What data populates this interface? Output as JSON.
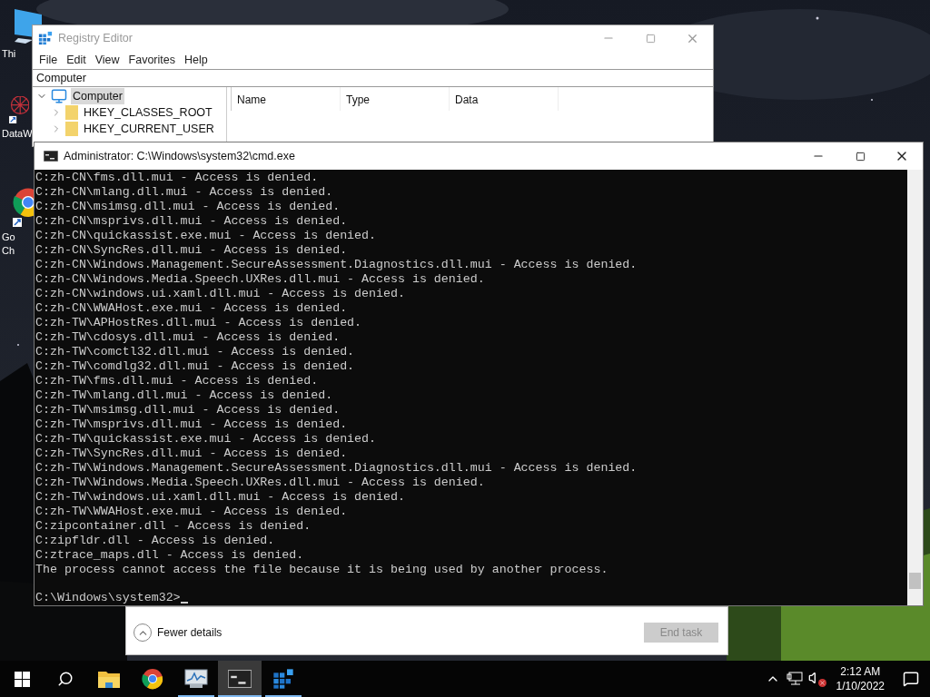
{
  "desktop_icons": [
    {
      "kind": "pc",
      "lines": [
        "Thi"
      ]
    },
    {
      "kind": "network",
      "lines": [
        "DataW"
      ]
    },
    {
      "kind": "chrome",
      "lines": [
        "Go",
        "Ch"
      ]
    }
  ],
  "registry": {
    "title": "Registry Editor",
    "menu": [
      "File",
      "Edit",
      "View",
      "Favorites",
      "Help"
    ],
    "address": "Computer",
    "tree": {
      "label": "Computer",
      "selected": true,
      "expanded": true,
      "children": [
        {
          "label": "HKEY_CLASSES_ROOT",
          "expanded": false
        },
        {
          "label": "HKEY_CURRENT_USER",
          "expanded": false
        }
      ]
    },
    "columns": [
      "Name",
      "Type",
      "Data"
    ]
  },
  "cmd": {
    "title": "Administrator: C:\\Windows\\system32\\cmd.exe",
    "lines": [
      "C:zh-CN\\fms.dll.mui - Access is denied.",
      "C:zh-CN\\mlang.dll.mui - Access is denied.",
      "C:zh-CN\\msimsg.dll.mui - Access is denied.",
      "C:zh-CN\\msprivs.dll.mui - Access is denied.",
      "C:zh-CN\\quickassist.exe.mui - Access is denied.",
      "C:zh-CN\\SyncRes.dll.mui - Access is denied.",
      "C:zh-CN\\Windows.Management.SecureAssessment.Diagnostics.dll.mui - Access is denied.",
      "C:zh-CN\\Windows.Media.Speech.UXRes.dll.mui - Access is denied.",
      "C:zh-CN\\windows.ui.xaml.dll.mui - Access is denied.",
      "C:zh-CN\\WWAHost.exe.mui - Access is denied.",
      "C:zh-TW\\APHostRes.dll.mui - Access is denied.",
      "C:zh-TW\\cdosys.dll.mui - Access is denied.",
      "C:zh-TW\\comctl32.dll.mui - Access is denied.",
      "C:zh-TW\\comdlg32.dll.mui - Access is denied.",
      "C:zh-TW\\fms.dll.mui - Access is denied.",
      "C:zh-TW\\mlang.dll.mui - Access is denied.",
      "C:zh-TW\\msimsg.dll.mui - Access is denied.",
      "C:zh-TW\\msprivs.dll.mui - Access is denied.",
      "C:zh-TW\\quickassist.exe.mui - Access is denied.",
      "C:zh-TW\\SyncRes.dll.mui - Access is denied.",
      "C:zh-TW\\Windows.Management.SecureAssessment.Diagnostics.dll.mui - Access is denied.",
      "C:zh-TW\\Windows.Media.Speech.UXRes.dll.mui - Access is denied.",
      "C:zh-TW\\windows.ui.xaml.dll.mui - Access is denied.",
      "C:zh-TW\\WWAHost.exe.mui - Access is denied.",
      "C:zipcontainer.dll - Access is denied.",
      "C:zipfldr.dll - Access is denied.",
      "C:ztrace_maps.dll - Access is denied.",
      "The process cannot access the file because it is being used by another process."
    ],
    "prompt": "C:\\Windows\\system32>"
  },
  "task_manager": {
    "details_toggle": "Fewer details",
    "end_task": {
      "label": "End task",
      "disabled": true
    }
  },
  "taskbar": {
    "items": [
      {
        "kind": "start",
        "running": false,
        "selected": false
      },
      {
        "kind": "search",
        "running": false,
        "selected": false
      },
      {
        "kind": "explorer",
        "running": false,
        "selected": false
      },
      {
        "kind": "chrome",
        "running": false,
        "selected": false
      },
      {
        "kind": "taskmgr",
        "running": true,
        "selected": false
      },
      {
        "kind": "cmd",
        "running": true,
        "selected": true
      },
      {
        "kind": "regedit",
        "running": true,
        "selected": false
      }
    ],
    "tray": {
      "volume_muted": true,
      "time": "2:12 AM",
      "date": "1/10/2022"
    }
  }
}
